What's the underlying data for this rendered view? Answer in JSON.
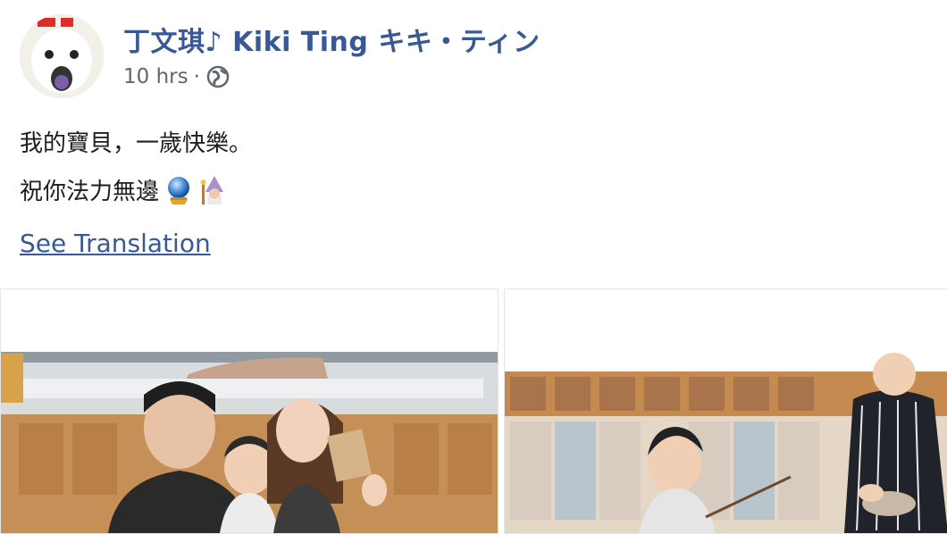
{
  "post": {
    "author_name": "丁文琪♪ Kiki Ting キキ・ティン",
    "timestamp": "10 hrs",
    "separator": "·",
    "privacy_icon": "globe-icon",
    "lines": [
      "我的寶貝，一歲快樂。",
      "祝你法力無邊"
    ],
    "emojis": [
      "crystal-ball-icon",
      "mage-icon"
    ],
    "see_translation": "See Translation"
  },
  "photos": [
    {
      "name": "family-photo"
    },
    {
      "name": "toddler-photo"
    }
  ],
  "colors": {
    "link": "#385898",
    "meta": "#606770",
    "text": "#1c1e21"
  }
}
